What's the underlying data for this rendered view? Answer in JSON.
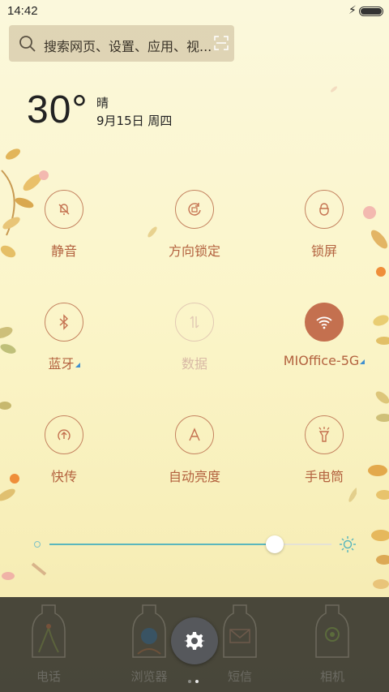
{
  "status_bar": {
    "time": "14:42",
    "charging_icon": "bolt-icon",
    "battery_level": 1.0
  },
  "search": {
    "placeholder": "搜索网页、设置、应用、视...",
    "search_icon": "search-icon",
    "scan_icon": "scan-icon"
  },
  "weather": {
    "temperature": "30°",
    "condition": "晴",
    "date": "9月15日 周四"
  },
  "toggles": [
    {
      "label": "静音",
      "icon": "bell-off-icon",
      "state": "off"
    },
    {
      "label": "方向锁定",
      "icon": "rotation-lock-icon",
      "state": "off"
    },
    {
      "label": "锁屏",
      "icon": "lock-icon",
      "state": "off"
    },
    {
      "label": "蓝牙",
      "icon": "bluetooth-icon",
      "state": "off",
      "expandable": true
    },
    {
      "label": "数据",
      "icon": "data-icon",
      "state": "disabled"
    },
    {
      "label": "MIOffice-5G",
      "icon": "wifi-icon",
      "state": "on",
      "expandable": true
    },
    {
      "label": "快传",
      "icon": "transfer-icon",
      "state": "off"
    },
    {
      "label": "自动亮度",
      "icon": "auto-brightness-icon",
      "state": "off"
    },
    {
      "label": "手电筒",
      "icon": "flashlight-icon",
      "state": "off"
    }
  ],
  "brightness": {
    "level": 0.8
  },
  "dock": {
    "apps": [
      "电话",
      "浏览器",
      "短信",
      "相机"
    ],
    "settings_icon": "gear-icon",
    "page_count": 2,
    "active_page": 2
  },
  "colors": {
    "accent": "#c4704f",
    "slider": "#5bb7bd",
    "dock_bg": "#3a3830"
  }
}
